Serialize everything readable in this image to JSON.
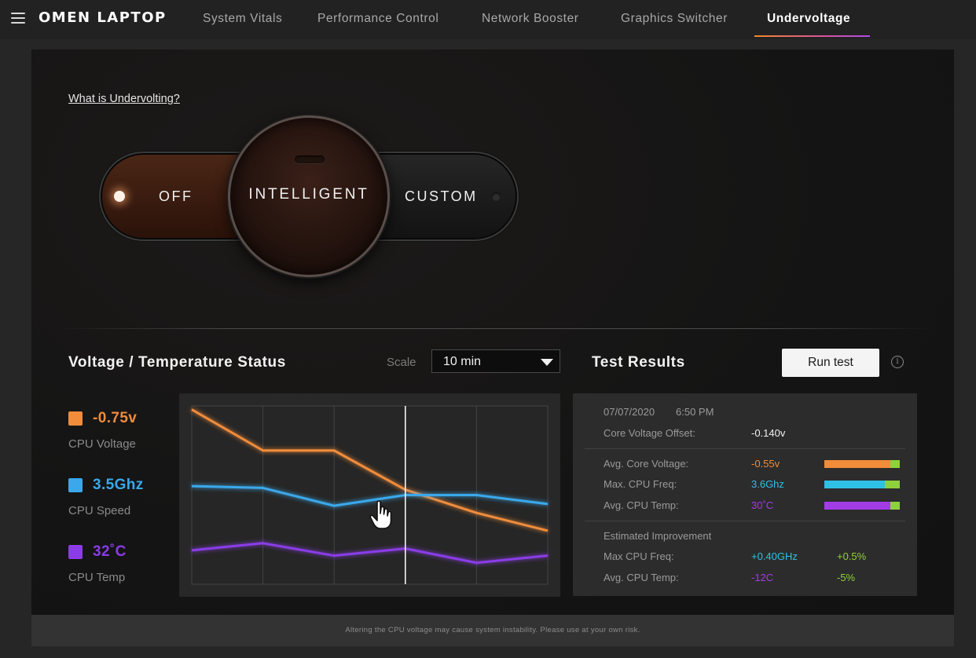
{
  "app": {
    "title": "OMEN LAPTOP"
  },
  "nav": {
    "tabs": [
      {
        "label": "System Vitals"
      },
      {
        "label": "Performance Control"
      },
      {
        "label": "Network Booster"
      },
      {
        "label": "Graphics Switcher"
      },
      {
        "label": "Undervoltage"
      }
    ],
    "active": "Undervoltage"
  },
  "help_link": "What is Undervolting?",
  "mode_toggle": {
    "options": [
      "OFF",
      "INTELLIGENT",
      "CUSTOM"
    ],
    "selected": "INTELLIGENT"
  },
  "status": {
    "title": "Voltage / Temperature Status",
    "scale_label": "Scale",
    "scale_value": "10 min",
    "legend": [
      {
        "value": "-0.75v",
        "label": "CPU Voltage",
        "color": "#f08c3a"
      },
      {
        "value": "3.5Ghz",
        "label": "CPU Speed",
        "color": "#3aa8ea"
      },
      {
        "value": "32˚C",
        "label": "CPU Temp",
        "color": "#8a3ce6"
      }
    ]
  },
  "chart_data": {
    "type": "line",
    "x": [
      0,
      1,
      2,
      3,
      4,
      5
    ],
    "series": [
      {
        "values": [
          98,
          75,
          75,
          53,
          40,
          30
        ],
        "color": "#f08c3a"
      },
      {
        "values": [
          55,
          54,
          44,
          50,
          50,
          45
        ],
        "color": "#3aa8ea"
      },
      {
        "values": [
          19,
          23,
          16,
          20,
          12,
          16
        ],
        "color": "#8a3ce6"
      }
    ],
    "ylim": [
      0,
      100
    ],
    "grid": true,
    "cursor_x": 3
  },
  "test_results": {
    "title": "Test Results",
    "run_button": "Run test",
    "date": "07/07/2020",
    "time": "6:50 PM",
    "offset_label": "Core Voltage Offset:",
    "offset_value": "-0.140v",
    "metrics": [
      {
        "label": "Avg. Core Voltage:",
        "value": "-0.55v",
        "color": "#f08c3a",
        "bar_fraction": 0.88
      },
      {
        "label": "Max. CPU Freq:",
        "value": "3.6Ghz",
        "color": "#2fc0e6",
        "bar_fraction": 0.8
      },
      {
        "label": "Avg. CPU Temp:",
        "value": "30˚C",
        "color": "#a23ce6",
        "bar_fraction": 0.88
      }
    ],
    "improvement_title": "Estimated Improvement",
    "improvements": [
      {
        "label": "Max CPU Freq:",
        "value": "+0.40GHz",
        "value_color": "#2fc0e6",
        "percent": "+0.5%"
      },
      {
        "label": "Avg. CPU Temp:",
        "value": "-12C",
        "value_color": "#a23ce6",
        "percent": "-5%"
      }
    ],
    "percent_color": "#8fd13c"
  },
  "footer": "Altering the CPU voltage may cause system instability. Please use at your own risk."
}
